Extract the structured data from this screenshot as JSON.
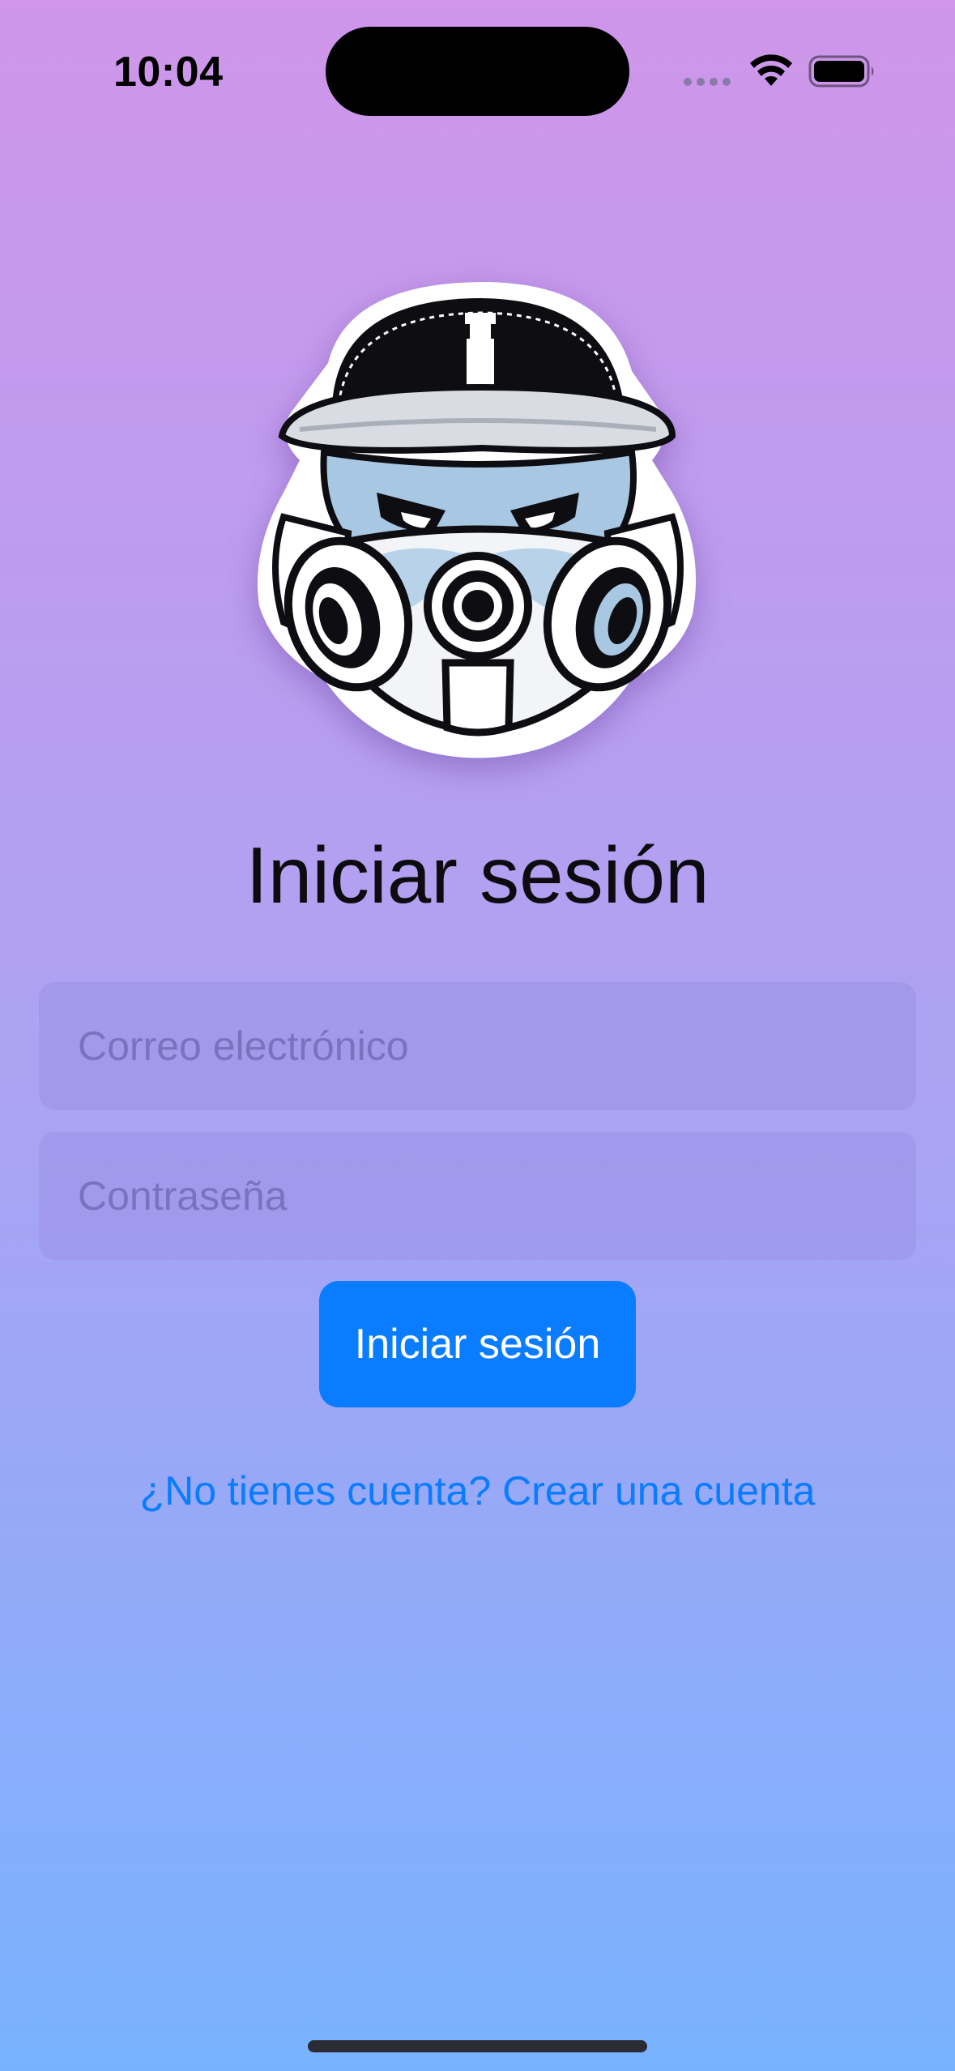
{
  "status_bar": {
    "time": "10:04",
    "icons": [
      "signal-dots-icon",
      "wifi-icon",
      "battery-icon"
    ]
  },
  "logo": {
    "icon": "gas-mask-character-logo"
  },
  "login": {
    "title": "Iniciar sesión",
    "email_placeholder": "Correo electrónico",
    "password_placeholder": "Contraseña",
    "button_label": "Iniciar sesión",
    "signup_link": "¿No tienes cuenta? Crear una cuenta"
  },
  "colors": {
    "gradient_top": "#cf96ea",
    "gradient_mid": "#aaa3f3",
    "gradient_bottom": "#78b2fe",
    "accent": "#0a7cff"
  }
}
